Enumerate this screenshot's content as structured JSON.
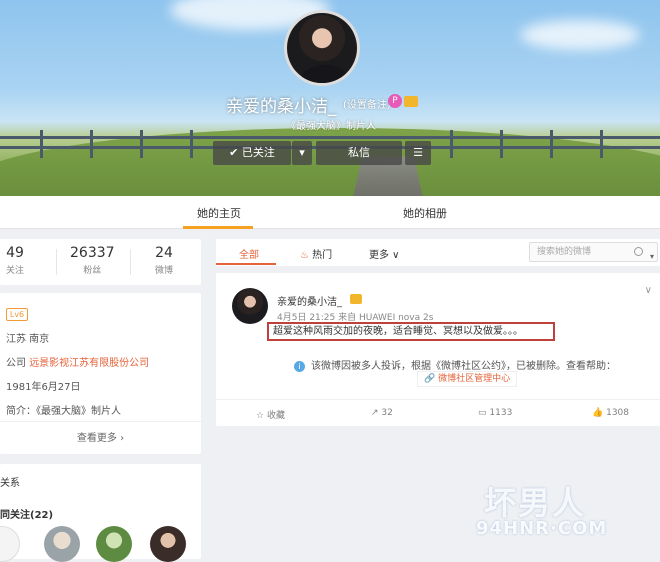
{
  "profile": {
    "name": "亲爱的桑小洁_",
    "remark": "(设置备注)",
    "bio": "《最强大脑》制片人",
    "vip_badge": "P",
    "buttons": {
      "follow": "✔ 已关注",
      "message": "私信"
    }
  },
  "tabs": {
    "home": "她的主页",
    "album": "她的相册"
  },
  "stats": [
    {
      "value": "49",
      "label": "关注"
    },
    {
      "value": "26337",
      "label": "粉丝"
    },
    {
      "value": "24",
      "label": "微博"
    }
  ],
  "info": {
    "level": "Lv6",
    "location": "江苏 南京",
    "company_label": "公司",
    "company": "远景影视江苏有限股份公司",
    "birthday": "1981年6月27日",
    "intro": "简介：《最强大脑》制片人",
    "more": "查看更多 ›"
  },
  "relations": {
    "title": "关系",
    "common_follow": "同关注(22)"
  },
  "filters": {
    "all": "全部",
    "hot": "热门",
    "more": "更多 ∨"
  },
  "search": {
    "placeholder": "搜索她的微博"
  },
  "post": {
    "author": "亲爱的桑小洁_",
    "meta": "4月5日 21:25 来自 HUAWEI nova 2s",
    "text": "超爱这种风雨交加的夜晚，适合睡觉、冥想以及做爱。。。",
    "notice": "该微博因被多人投诉，根据《微博社区公约》，已被删除。查看帮助：",
    "notice_link": "微博社区管理中心",
    "actions": {
      "favorite": "收藏",
      "repost": "32",
      "comment": "1133",
      "like": "1308"
    }
  },
  "watermark": {
    "brand": "坏男人",
    "url": "94HNR·COM"
  },
  "colors": {
    "accent": "#f7a123",
    "link": "#e6623a",
    "highlight_border": "#c0413b"
  }
}
